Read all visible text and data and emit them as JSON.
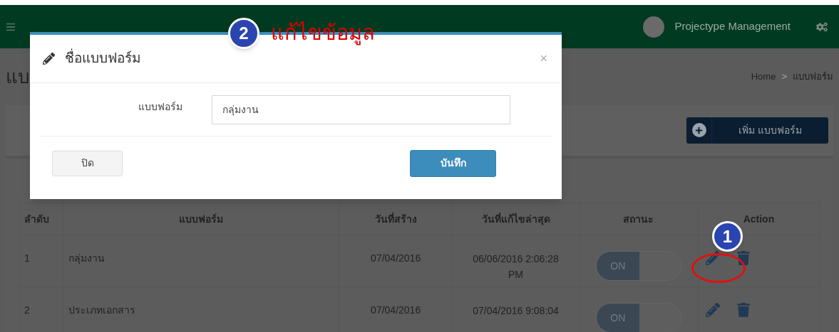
{
  "header": {
    "app_name": "Projectype Management"
  },
  "page": {
    "title": "แบ",
    "breadcrumb": [
      "Home",
      "แบบฟอร์ม"
    ],
    "breadcrumb_separator": ">"
  },
  "toolbar": {
    "add_button": "เพิ่ม แบบฟอร์ม"
  },
  "table": {
    "columns": [
      "ลำดับ",
      "แบบฟอร์ม",
      "วันที่สร้าง",
      "วันที่แก้ไขล่าสุด",
      "สถานะ",
      "Action"
    ],
    "rows": [
      {
        "no": "1",
        "name": "กลุ่มงาน",
        "created": "07/04/2016",
        "modified": "06/06/2016 2:06:28 PM",
        "status": {
          "label": "ON",
          "on": true
        }
      },
      {
        "no": "2",
        "name": "ประเภทเอกสาร",
        "created": "07/04/2016",
        "modified": "07/04/2016 9:08:04",
        "status": {
          "label": "ON",
          "on": true
        }
      }
    ]
  },
  "modal": {
    "title": "ชื่อแบบฟอร์ม",
    "close": "×",
    "field_label": "แบบฟอร์ม",
    "field_value": "กลุ่มงาน",
    "buttons": [
      "ปิด",
      "บันทึก"
    ]
  },
  "annotations": [
    {
      "number": "1",
      "circled": true
    },
    {
      "number": "2",
      "text": "แก้ไขข้อมูล",
      "circled": false
    }
  ]
}
